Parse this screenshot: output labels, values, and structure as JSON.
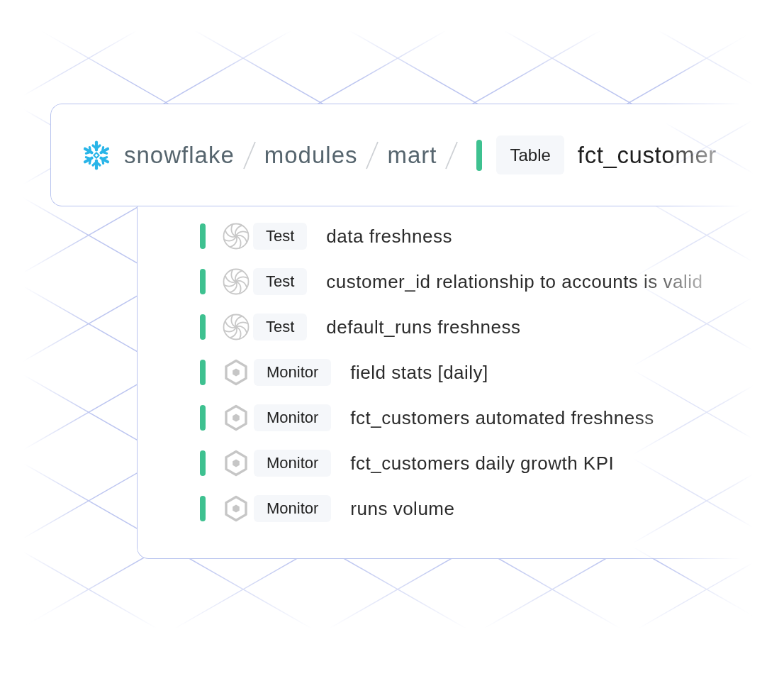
{
  "breadcrumb": {
    "source": "snowflake",
    "path": [
      "modules",
      "mart"
    ]
  },
  "asset": {
    "type_label": "Table",
    "name": "fct_customer"
  },
  "checks": [
    {
      "kind": "test",
      "label": "Test",
      "title": "data freshness"
    },
    {
      "kind": "test",
      "label": "Test",
      "title": "customer_id relationship to accounts is valid"
    },
    {
      "kind": "test",
      "label": "Test",
      "title": "default_runs freshness"
    },
    {
      "kind": "monitor",
      "label": "Monitor",
      "title": "field stats [daily]"
    },
    {
      "kind": "monitor",
      "label": "Monitor",
      "title": "fct_customers automated freshness"
    },
    {
      "kind": "monitor",
      "label": "Monitor",
      "title": "fct_customers daily growth KPI"
    },
    {
      "kind": "monitor",
      "label": "Monitor",
      "title": "runs volume"
    }
  ]
}
